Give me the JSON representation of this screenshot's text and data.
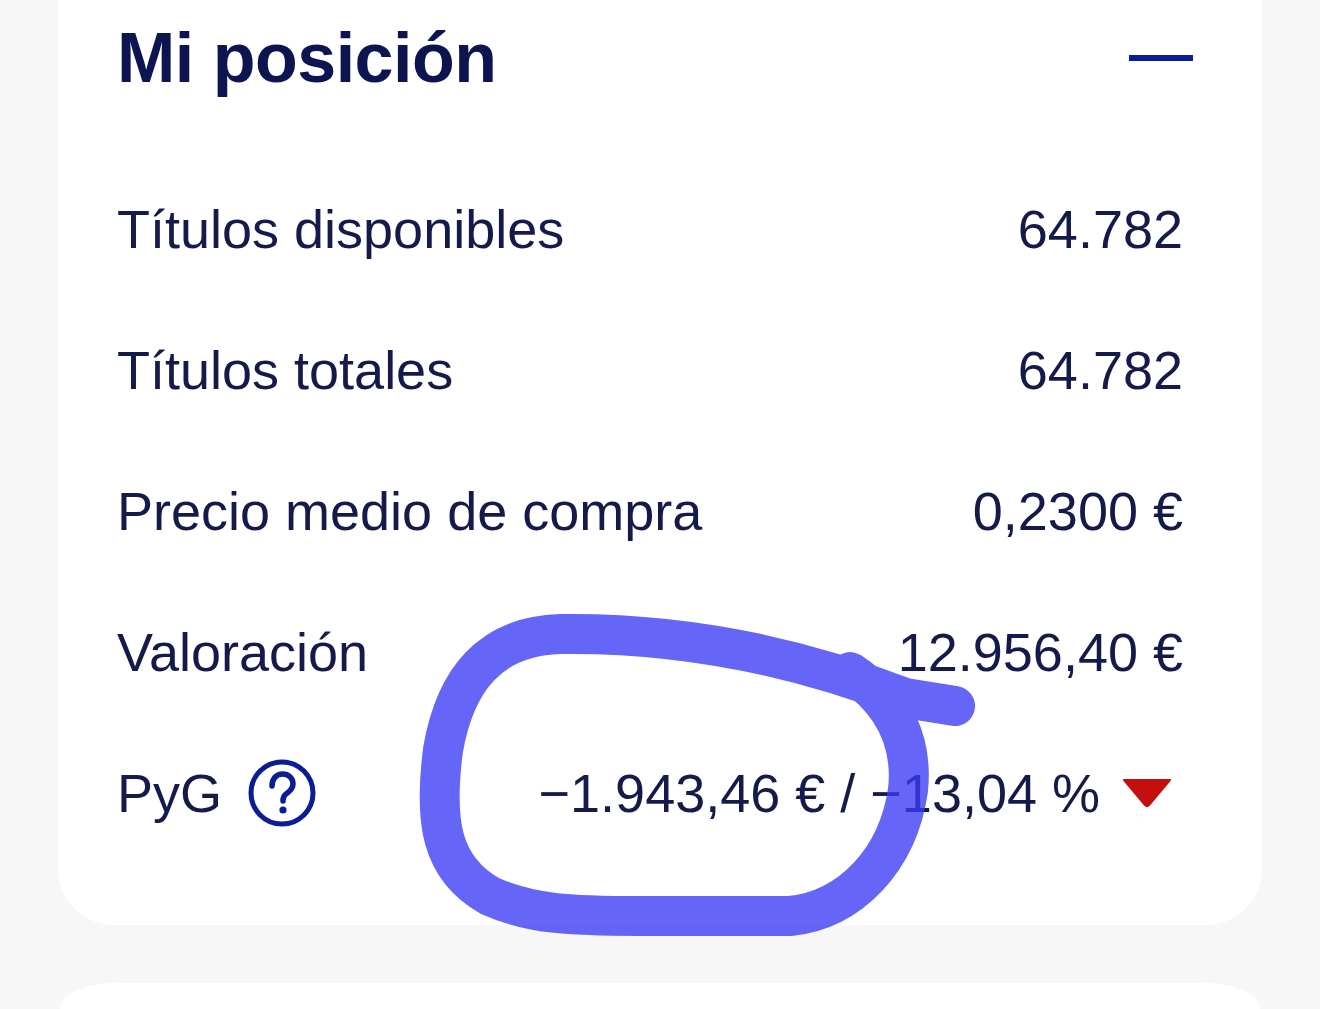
{
  "position_card": {
    "title": "Mi posición",
    "expanded": true,
    "rows": [
      {
        "kind": "plain",
        "label": "Títulos disponibles",
        "value": "64.782"
      },
      {
        "kind": "plain",
        "label": "Títulos totales",
        "value": "64.782"
      },
      {
        "kind": "plain",
        "label": "Precio medio de compra",
        "value": "0,2300 €"
      },
      {
        "kind": "plain",
        "label": "Valoración",
        "value": "12.956,40 €"
      },
      {
        "kind": "gain_loss",
        "label": "PyG",
        "value": "−1.943,46 € / −13,04 %",
        "falling": true
      }
    ]
  }
}
